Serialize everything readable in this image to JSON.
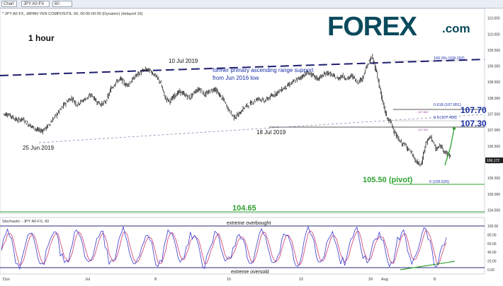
{
  "toolbar": {
    "chart_tab": "Chart",
    "symbol_box": "JPY A0-FX",
    "interval_box": "60"
  },
  "header": {
    "instrument_line": "* JPY A0-FX, JAPAN YEN COMPOSITE, 60, 00:00-00:00 (Dynamic) (delayed 15)"
  },
  "logo": {
    "text": "FOREX",
    "suffix": ".com",
    "color": "#0a4a5c"
  },
  "timeframe": "1 hour",
  "annotations": {
    "range_support": "former primary ascending range support",
    "range_support_2": "from Jun 2016 low",
    "high_date": "10 Jul 2019",
    "low_date_1": "25 Jun 2019",
    "low_date_2": "18 Jul 2019",
    "fib_100": "100.0% (109.292)",
    "fib_618": "0.618 (107.851)",
    "fib_5": "0.5 (107.406)",
    "fib_0": "0 (105.520)",
    "small_label_1": "107.651",
    "small_label_2": "107.091",
    "level_1077": "107.70",
    "level_1073": "107.30",
    "pivot": "105.50 (pivot)",
    "support_10465": "104.65",
    "price_tag": "106.172",
    "overbought": "extreme overbought",
    "oversold": "extreme oversold"
  },
  "stochastic_label": "Stochastic - JPY A0-FX, 60",
  "price_axis": [
    "110.500",
    "110.000",
    "109.500",
    "109.000",
    "108.500",
    "108.000",
    "107.500",
    "107.000",
    "106.500",
    "106.172",
    "106.000",
    "105.500",
    "105.000",
    "104.500"
  ],
  "stoch_axis": [
    "100.00",
    "80.00",
    "60.00",
    "40.00",
    "20.00",
    "0.00"
  ],
  "time_axis": [
    "Dyn",
    "Jul",
    "8",
    "15",
    "22",
    "29",
    "Aug",
    "8"
  ],
  "colors": {
    "bar": "#222222",
    "dash_line": "#1e1e6e",
    "accent_blue": "#1a2ea8",
    "green": "#2ea02e",
    "stoch_k": "#3a3acc",
    "stoch_d": "#cc3a6e",
    "level_line": "#2a2a7a"
  },
  "chart_data": {
    "type": "ohlc",
    "title": "",
    "ylim": [
      104.4,
      110.8
    ],
    "x": [
      0,
      1,
      2,
      3,
      4,
      5,
      6,
      7,
      8,
      9,
      10,
      11,
      12,
      13,
      14,
      15,
      16,
      17,
      18,
      19,
      20,
      21,
      22,
      23,
      24,
      25,
      26,
      27,
      28,
      29,
      30,
      31,
      32,
      33,
      34,
      35,
      36,
      37,
      38,
      39,
      40,
      41,
      42,
      43,
      44,
      45,
      46,
      47,
      48,
      49,
      50,
      51,
      52,
      53,
      54,
      55,
      56,
      57,
      58,
      59,
      60,
      61,
      62,
      63,
      64,
      65,
      66,
      67,
      68,
      69,
      70,
      71,
      72,
      73,
      74,
      75,
      76,
      77,
      78,
      79,
      80,
      81,
      82,
      83,
      84,
      85,
      86,
      87,
      88,
      89,
      90
    ],
    "close": [
      107.5,
      107.4,
      107.3,
      107.35,
      107.2,
      107.1,
      107.0,
      106.98,
      107.1,
      107.3,
      107.5,
      107.7,
      107.9,
      108.0,
      107.8,
      107.9,
      108.0,
      108.1,
      107.9,
      107.8,
      107.9,
      108.3,
      108.5,
      108.6,
      108.4,
      108.5,
      108.7,
      108.8,
      108.9,
      108.85,
      108.7,
      108.5,
      108.0,
      107.9,
      108.1,
      108.2,
      108.1,
      108.0,
      108.2,
      108.3,
      108.1,
      108.2,
      108.3,
      108.1,
      107.9,
      107.6,
      107.4,
      107.5,
      107.7,
      107.8,
      107.9,
      108.0,
      107.9,
      108.0,
      108.1,
      108.2,
      108.3,
      108.4,
      108.5,
      108.6,
      108.7,
      108.8,
      108.7,
      108.6,
      108.7,
      108.8,
      108.7,
      108.6,
      108.7,
      108.6,
      108.7,
      108.5,
      108.6,
      109.0,
      109.29,
      108.8,
      108.0,
      107.4,
      107.2,
      106.8,
      106.6,
      106.5,
      106.3,
      106.0,
      105.9,
      106.6,
      106.8,
      106.4,
      106.5,
      106.3,
      106.17
    ],
    "stoch_ylim": [
      0,
      100
    ],
    "stoch_levels": [
      80,
      20
    ]
  }
}
